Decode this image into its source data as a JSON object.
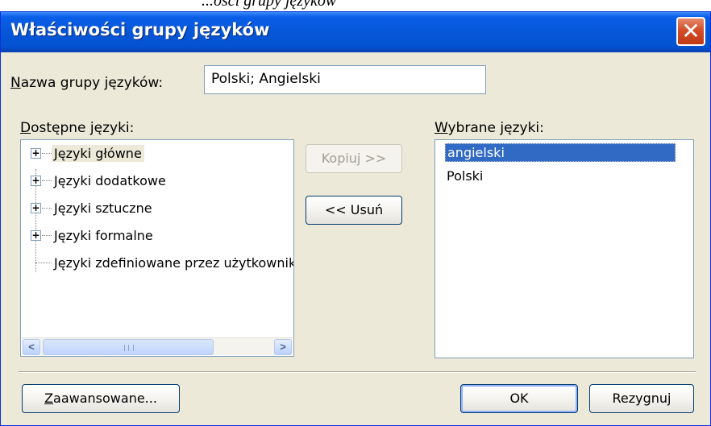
{
  "top_fragment": {
    "italic_text": "...ości grupy języków",
    "bold_text": "grupy języków"
  },
  "window": {
    "title": "Właściwości grupy języków",
    "close_glyph": "✕"
  },
  "group_name": {
    "label_prefix": "N",
    "label_rest": "azwa grupy języków:",
    "value": "Polski; Angielski"
  },
  "available": {
    "label_prefix": "D",
    "label_rest": "ostępne języki:",
    "items": [
      {
        "label": "Języki główne",
        "expander": "+"
      },
      {
        "label": "Języki dodatkowe",
        "expander": "+"
      },
      {
        "label": "Języki sztuczne",
        "expander": "+"
      },
      {
        "label": "Języki formalne",
        "expander": "+"
      },
      {
        "label": "Języki zdefiniowane przez użytkownika",
        "expander": ""
      }
    ],
    "scroll": {
      "left_arrow": "<",
      "right_arrow": ">"
    }
  },
  "actions": {
    "copy_label": "Kopiuj >>",
    "remove_label": "<< Usuń"
  },
  "selected": {
    "label_prefix": "W",
    "label_rest": "ybrane języki:",
    "items": [
      {
        "label": "angielski"
      },
      {
        "label": "Polski"
      }
    ]
  },
  "footer": {
    "advanced_prefix": "Z",
    "advanced_rest": "aawansowane...",
    "ok_label": "OK",
    "cancel_label": "Rezygnuj"
  },
  "colors": {
    "titlebar": "#0656d8",
    "dialog_bg": "#ece9d8",
    "selection": "#316ac5",
    "close_button": "#d24d28"
  }
}
